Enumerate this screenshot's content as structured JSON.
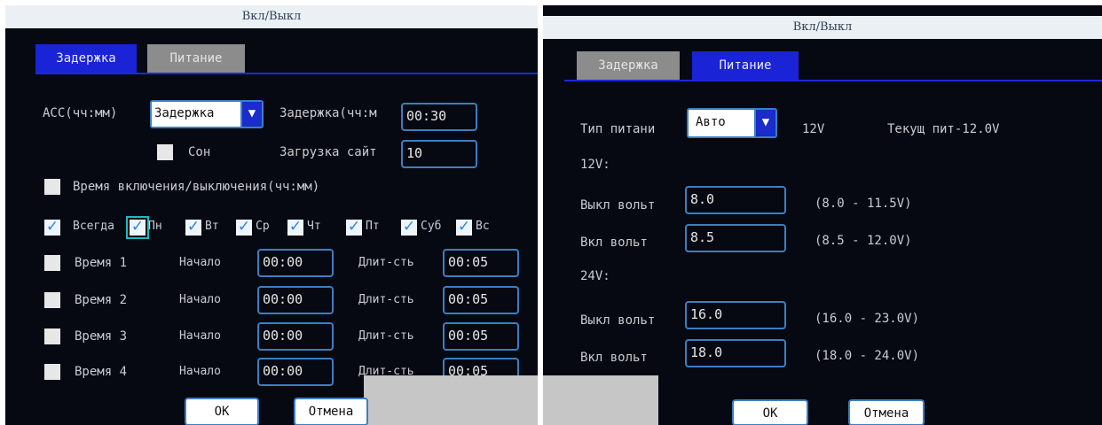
{
  "left": {
    "title": "Вкл/Выкл",
    "tabs": [
      "Задержка",
      "Питание"
    ],
    "acc_label": "ACC(чч:мм)",
    "acc_select": "Задержка",
    "delay_label": "Задержка(чч:м",
    "delay_value": "00:30",
    "sleep_label": "Сон",
    "upload_label": "Загрузка сайт",
    "upload_value": "10",
    "time_onoff_label": "Время включения/выключения(чч:мм)",
    "days": [
      "Всегда",
      "Пн",
      "Вт",
      "Ср",
      "Чт",
      "Пт",
      "Суб",
      "Вс"
    ],
    "schedule": [
      {
        "label": "Время 1",
        "start_label": "Начало",
        "start": "00:00",
        "dur_label": "Длит-сть",
        "dur": "00:05"
      },
      {
        "label": "Время 2",
        "start_label": "Начало",
        "start": "00:00",
        "dur_label": "Длит-сть",
        "dur": "00:05"
      },
      {
        "label": "Время 3",
        "start_label": "Начало",
        "start": "00:00",
        "dur_label": "Длит-сть",
        "dur": "00:05"
      },
      {
        "label": "Время 4",
        "start_label": "Начало",
        "start": "00:00",
        "dur_label": "Длит-сть",
        "dur": "00:05"
      }
    ],
    "ok": "ОК",
    "cancel": "Отмена"
  },
  "right": {
    "title": "Вкл/Выкл",
    "tabs": [
      "Задержка",
      "Питание"
    ],
    "power_type_label": "Тип питани",
    "power_type_value": "Авто",
    "voltage_text": "12V",
    "current_text": "Текущ пит-12.0V",
    "v12_label": "12V:",
    "v24_label": "24V:",
    "rows": [
      {
        "label": "Выкл вольт",
        "value": "8.0",
        "range": "(8.0 - 11.5V)"
      },
      {
        "label": "Вкл вольт",
        "value": "8.5",
        "range": "(8.5 - 12.0V)"
      },
      {
        "label": "Выкл вольт",
        "value": "16.0",
        "range": "(16.0 - 23.0V)"
      },
      {
        "label": "Вкл вольт",
        "value": "18.0",
        "range": "(18.0 - 24.0V)"
      }
    ],
    "ok": "ОК",
    "cancel": "Отмена"
  },
  "colors": {
    "panel_bg": "#060912",
    "active_tab": "#1a23d6",
    "field_border": "#3a7fc4",
    "title_bar": "#eaf0f4"
  }
}
